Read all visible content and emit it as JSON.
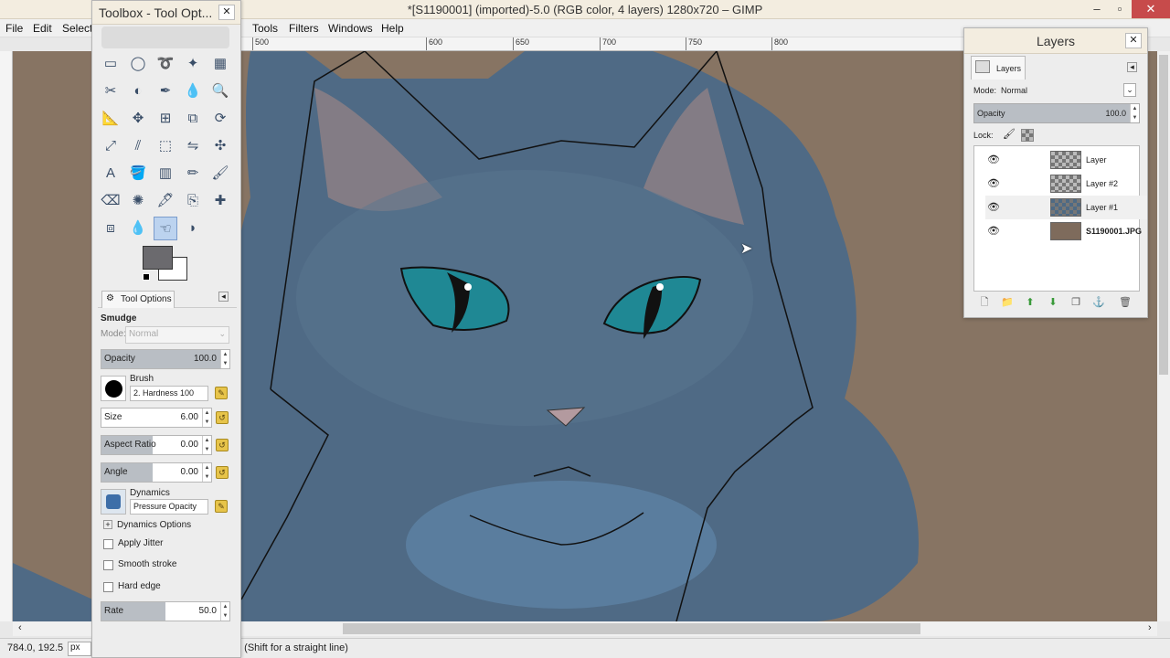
{
  "window": {
    "title": "*[S1190001] (imported)-5.0 (RGB color, 4 layers) 1280x720 – GIMP",
    "minimize": "–",
    "maximize": "▫",
    "close": "✕"
  },
  "menubar": [
    "File",
    "Edit",
    "Select",
    "Tools",
    "Filters",
    "Windows",
    "Help"
  ],
  "ruler_top": [
    "500",
    "600",
    "650",
    "700",
    "750",
    "800"
  ],
  "status": {
    "coords": "784.0, 192.5",
    "unit": "px",
    "message": "e (Shift for a straight line)"
  },
  "toolbox": {
    "title": "Toolbox - Tool Opt...",
    "tools": [
      "rect-select",
      "ellipse-select",
      "free-select",
      "fuzzy-select",
      "color-select",
      "scissors",
      "foreground-select",
      "paths",
      "color-picker",
      "zoom",
      "measure",
      "move",
      "align",
      "crop",
      "rotate",
      "scale",
      "shear",
      "perspective",
      "flip",
      "cage",
      "text",
      "bucket-fill",
      "blend",
      "pencil",
      "paintbrush",
      "eraser",
      "airbrush",
      "ink",
      "clone",
      "heal",
      "perspective-clone",
      "blur",
      "smudge",
      "dodge"
    ],
    "tab_label": "Tool Options",
    "tool_name": "Smudge",
    "mode_label": "Mode:",
    "mode_value": "Normal",
    "opacity": {
      "label": "Opacity",
      "value": "100.0",
      "fill": 0.93
    },
    "brush": {
      "label": "Brush",
      "value": "2. Hardness 100"
    },
    "size": {
      "label": "Size",
      "value": "6.00",
      "fill": 0.0
    },
    "aspect": {
      "label": "Aspect Ratio",
      "value": "0.00",
      "fill": 0.0
    },
    "angle": {
      "label": "Angle",
      "value": "0.00",
      "fill": 0.0
    },
    "dynamics": {
      "label": "Dynamics",
      "value": "Pressure Opacity"
    },
    "dynamics_options": "Dynamics Options",
    "checkboxes": [
      "Apply Jitter",
      "Smooth stroke",
      "Hard edge"
    ],
    "rate": {
      "label": "Rate",
      "value": "50.0",
      "fill": 0.5
    }
  },
  "layers": {
    "title": "Layers",
    "tab": "Layers",
    "mode_label": "Mode:",
    "mode_value": "Normal",
    "opacity_label": "Opacity",
    "opacity_value": "100.0",
    "lock_label": "Lock:",
    "items": [
      {
        "name": "Layer",
        "bold": false
      },
      {
        "name": "Layer #2",
        "bold": false
      },
      {
        "name": "Layer #1",
        "bold": false
      },
      {
        "name": "S1190001.JPG",
        "bold": true
      }
    ]
  },
  "colors": {
    "fg": "#6b6a6e",
    "bg": "#ffffff",
    "fur": "#4e6a84",
    "eye": "#1f8894"
  }
}
